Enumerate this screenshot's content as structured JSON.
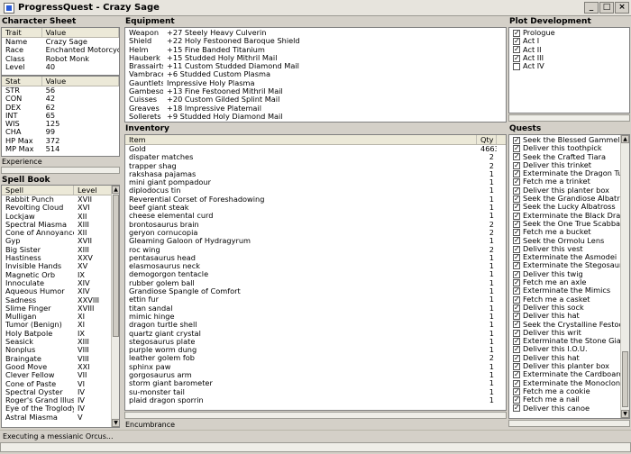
{
  "window": {
    "title": "ProgressQuest - Crazy Sage"
  },
  "character": {
    "title": "Character Sheet",
    "trait_header": [
      "Trait",
      "Value"
    ],
    "traits": [
      [
        "Name",
        "Crazy Sage"
      ],
      [
        "Race",
        "Enchanted Motorcycle"
      ],
      [
        "Class",
        "Robot Monk"
      ],
      [
        "Level",
        "40"
      ]
    ],
    "stat_header": [
      "Stat",
      "Value"
    ],
    "stats": [
      [
        "STR",
        "56"
      ],
      [
        "CON",
        "42"
      ],
      [
        "DEX",
        "62"
      ],
      [
        "INT",
        "65"
      ],
      [
        "WIS",
        "125"
      ],
      [
        "CHA",
        "99"
      ],
      [
        "HP Max",
        "372"
      ],
      [
        "MP Max",
        "514"
      ]
    ],
    "experience_label": "Experience"
  },
  "spellbook": {
    "title": "Spell Book",
    "header": [
      "Spell",
      "Level"
    ],
    "spells": [
      [
        "Rabbit Punch",
        "XVII"
      ],
      [
        "Revolting Cloud",
        "XVI"
      ],
      [
        "Lockjaw",
        "XII"
      ],
      [
        "Spectral Miasma",
        "XIII"
      ],
      [
        "Cone of Annoyance",
        "XII"
      ],
      [
        "Gyp",
        "XVII"
      ],
      [
        "Big Sister",
        "XIII"
      ],
      [
        "Hastiness",
        "XXV"
      ],
      [
        "Invisible Hands",
        "XV"
      ],
      [
        "Magnetic Orb",
        "IX"
      ],
      [
        "Innoculate",
        "XIV"
      ],
      [
        "Aqueous Humor",
        "XIV"
      ],
      [
        "Sadness",
        "XXVIII"
      ],
      [
        "Slime Finger",
        "XVIII"
      ],
      [
        "Mulligan",
        "XI"
      ],
      [
        "Tumor (Benign)",
        "XI"
      ],
      [
        "Holy Batpole",
        "IX"
      ],
      [
        "Seasick",
        "XIII"
      ],
      [
        "Nonplus",
        "VIII"
      ],
      [
        "Braingate",
        "VIII"
      ],
      [
        "Good Move",
        "XXI"
      ],
      [
        "Clever Fellow",
        "VII"
      ],
      [
        "Cone of Paste",
        "VI"
      ],
      [
        "Spectral Oyster",
        "IV"
      ],
      [
        "Roger's Grand Illusion",
        "IV"
      ],
      [
        "Eye of the Troglodyte",
        "IV"
      ],
      [
        "Astral Miasma",
        "V"
      ]
    ]
  },
  "equipment": {
    "title": "Equipment",
    "items": [
      [
        "Weapon",
        "+27 Steely Heavy Culverin"
      ],
      [
        "Shield",
        "+22 Holy Festooned Baroque Shield"
      ],
      [
        "Helm",
        "+15 Fine Banded Titanium"
      ],
      [
        "Hauberk",
        "+15 Studded Holy Mithril Mail"
      ],
      [
        "Brassairts",
        "+11 Custom Studded Diamond Mail"
      ],
      [
        "Vambraces",
        "+6 Studded Custom Plasma"
      ],
      [
        "Gauntlets",
        "Impressive Holy Plasma"
      ],
      [
        "Gambeson",
        "+13 Fine Festooned Mithril Mail"
      ],
      [
        "Cuisses",
        "+20 Custom Gilded Splint Mail"
      ],
      [
        "Greaves",
        "+18 Impressive Platemail"
      ],
      [
        "Sollerets",
        "+9 Studded Holy Diamond Mail"
      ]
    ]
  },
  "inventory": {
    "title": "Inventory",
    "header": [
      "Item",
      "Qty"
    ],
    "items": [
      [
        "Gold",
        "4663"
      ],
      [
        "dispater matches",
        "2"
      ],
      [
        "trapper shag",
        "2"
      ],
      [
        "rakshasa pajamas",
        "1"
      ],
      [
        "mini giant pompadour",
        "1"
      ],
      [
        "diplodocus tin",
        "1"
      ],
      [
        "Reverential Corset of Foreshadowing",
        "1"
      ],
      [
        "beef giant steak",
        "1"
      ],
      [
        "cheese elemental curd",
        "1"
      ],
      [
        "brontosaurus brain",
        "2"
      ],
      [
        "geryon cornucopia",
        "2"
      ],
      [
        "Gleaming Galoon of Hydragyrum",
        "1"
      ],
      [
        "roc wing",
        "2"
      ],
      [
        "pentasaurus head",
        "1"
      ],
      [
        "elasmosaurus neck",
        "1"
      ],
      [
        "demogorgon tentacle",
        "1"
      ],
      [
        "rubber golem ball",
        "1"
      ],
      [
        "Grandiose Spangle of Comfort",
        "1"
      ],
      [
        "ettin fur",
        "1"
      ],
      [
        "titan sandal",
        "1"
      ],
      [
        "mimic hinge",
        "1"
      ],
      [
        "dragon turtle shell",
        "1"
      ],
      [
        "quartz giant crystal",
        "1"
      ],
      [
        "stegosaurus plate",
        "1"
      ],
      [
        "purple worm dung",
        "1"
      ],
      [
        "leather golem fob",
        "2"
      ],
      [
        "sphinx paw",
        "1"
      ],
      [
        "gorgosaurus arm",
        "1"
      ],
      [
        "storm giant barometer",
        "1"
      ],
      [
        "su-monster tail",
        "1"
      ],
      [
        "plaid dragon sporrin",
        "1"
      ]
    ],
    "encumbrance_label": "Encumbrance"
  },
  "plot": {
    "title": "Plot Development",
    "acts": [
      [
        "Prologue",
        true
      ],
      [
        "Act I",
        true
      ],
      [
        "Act II",
        true
      ],
      [
        "Act III",
        true
      ],
      [
        "Act IV",
        false
      ]
    ]
  },
  "quests": {
    "title": "Quests",
    "items": [
      [
        "Seek the Blessed Gammel",
        true
      ],
      [
        "Deliver this toothpick",
        true
      ],
      [
        "Seek the Crafted Tiara",
        true
      ],
      [
        "Deliver this trinket",
        true
      ],
      [
        "Exterminate the Dragon Turtles",
        true
      ],
      [
        "Fetch me a trinket",
        true
      ],
      [
        "Deliver this planter box",
        true
      ],
      [
        "Seek the Grandiose Albatross",
        true
      ],
      [
        "Seek the Lucky Albatross",
        true
      ],
      [
        "Exterminate the Black Dragons",
        true
      ],
      [
        "Seek the One True Scabbard",
        true
      ],
      [
        "Fetch me a bucket",
        true
      ],
      [
        "Seek the Ormolu Lens",
        true
      ],
      [
        "Deliver this vest",
        true
      ],
      [
        "Exterminate the Asmodei",
        true
      ],
      [
        "Exterminate the Stegosauri",
        true
      ],
      [
        "Deliver this twig",
        true
      ],
      [
        "Fetch me an axle",
        true
      ],
      [
        "Exterminate the Mimics",
        true
      ],
      [
        "Fetch me a casket",
        true
      ],
      [
        "Deliver this sock",
        true
      ],
      [
        "Deliver this hat",
        true
      ],
      [
        "Seek the Crystalline Festoon",
        true
      ],
      [
        "Deliver this writ",
        true
      ],
      [
        "Exterminate the Stone Giants",
        true
      ],
      [
        "Deliver this I.O.U.",
        true
      ],
      [
        "Deliver this hat",
        true
      ],
      [
        "Deliver this planter box",
        true
      ],
      [
        "Exterminate the Cardboard Gole...",
        true
      ],
      [
        "Exterminate the Monoclonii",
        true
      ],
      [
        "Fetch me a cookie",
        true
      ],
      [
        "Fetch me a nail",
        true
      ],
      [
        "Deliver this canoe",
        true
      ]
    ]
  },
  "status": {
    "text": "Executing a messianic Orcus..."
  }
}
